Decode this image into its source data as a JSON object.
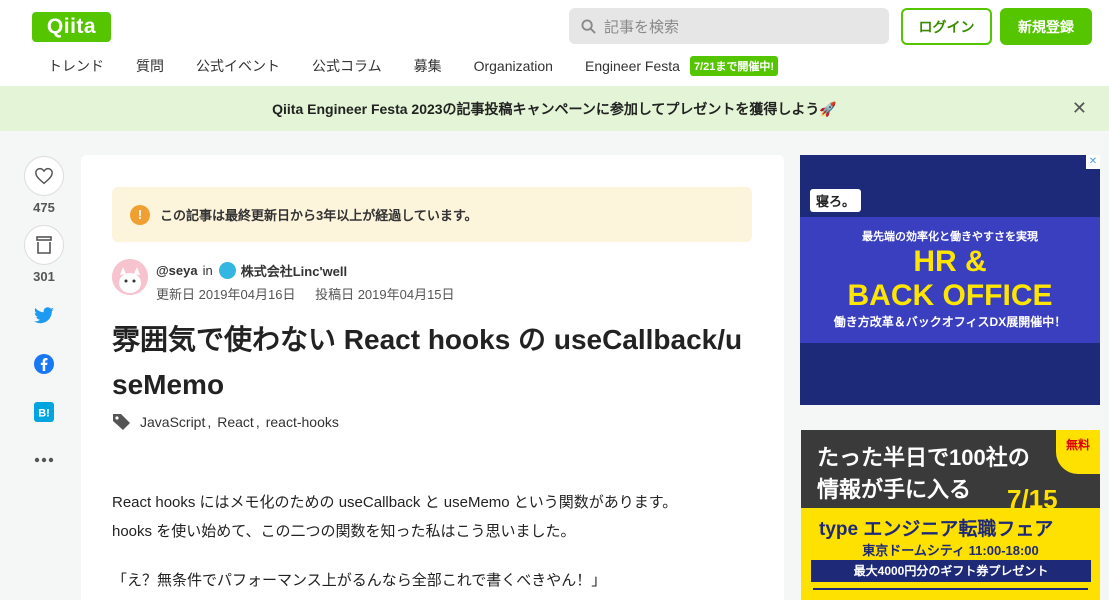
{
  "header": {
    "logo": "Qiita",
    "search_placeholder": "記事を検索",
    "login_label": "ログイン",
    "signup_label": "新規登録",
    "nav": [
      "トレンド",
      "質問",
      "公式イベント",
      "公式コラム",
      "募集",
      "Organization",
      "Engineer Festa"
    ],
    "nav_badge": "7/21まで開催中!"
  },
  "banner": {
    "text": "Qiita Engineer Festa 2023の記事投稿キャンペーンに参加してプレゼントを獲得しよう🚀",
    "close_icon": "close-icon"
  },
  "rail": {
    "like_count": "475",
    "stock_count": "301"
  },
  "article": {
    "notice": "この記事は最終更新日から3年以上が経過しています。",
    "author": "@seya",
    "in_text": "in",
    "organization": "株式会社Linc'well",
    "updated": "更新日 2019年04月16日",
    "posted": "投稿日 2019年04月15日",
    "title": "雰囲気で使わない React hooks の useCallback/useMemo",
    "tags": [
      "JavaScript",
      "React",
      "react-hooks"
    ],
    "body": [
      "React hooks にはメモ化のための useCallback と useMemo という関数があります。\nhooks を使い始めて、この二つの関数を知った私はこう思いました。",
      "「え？無条件でパフォーマンス上がるんなら全部これで書くべきやん！」"
    ]
  },
  "ads": {
    "ad1": {
      "badge": "寝ろ。",
      "sub": "最先端の効率化と働きやすさを実現",
      "main1": "HR &",
      "main2": "BACK OFFICE",
      "foot": "働き方改革＆バックオフィスDX展開催中！"
    },
    "ad2": {
      "line1": "たった半日で100社の",
      "line2": "情報が手に入る",
      "date": "7/15",
      "free": "無料",
      "brand": "type エンジニア転職フェア",
      "venue": "東京ドームシティ 11:00-18:00",
      "gift": "最大4000円分のギフト券プレゼント"
    }
  }
}
